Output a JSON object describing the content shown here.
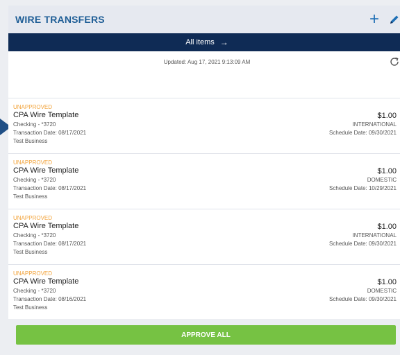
{
  "header": {
    "title": "WIRE TRANSFERS",
    "add_icon": "plus-icon",
    "edit_icon": "pencil-icon"
  },
  "filter_bar": {
    "label": "All items",
    "arrow": "→"
  },
  "status_row": {
    "updated_text": "Updated: Aug 17, 2021 9:13:09 AM",
    "refresh_icon": "refresh-icon"
  },
  "transfers": [
    {
      "status": "UNAPPROVED",
      "name": "CPA Wire Template",
      "account": "Checking - *3720",
      "transaction_date": "Transaction Date: 08/17/2021",
      "business": "Test Business",
      "amount": "$1.00",
      "type": "INTERNATIONAL",
      "schedule_date": "Schedule Date: 09/30/2021",
      "chevron": ">"
    },
    {
      "status": "UNAPPROVED",
      "name": "CPA Wire Template",
      "account": "Checking - *3720",
      "transaction_date": "Transaction Date: 08/17/2021",
      "business": "Test Business",
      "amount": "$1.00",
      "type": "DOMESTIC",
      "schedule_date": "Schedule Date: 10/29/2021",
      "chevron": ">"
    },
    {
      "status": "UNAPPROVED",
      "name": "CPA Wire Template",
      "account": "Checking - *3720",
      "transaction_date": "Transaction Date: 08/17/2021",
      "business": "Test Business",
      "amount": "$1.00",
      "type": "INTERNATIONAL",
      "schedule_date": "Schedule Date: 09/30/2021",
      "chevron": ">"
    },
    {
      "status": "UNAPPROVED",
      "name": "CPA Wire Template",
      "account": "Checking - *3720",
      "transaction_date": "Transaction Date: 08/16/2021",
      "business": "Test Business",
      "amount": "$1.00",
      "type": "DOMESTIC",
      "schedule_date": "Schedule Date: 09/30/2021",
      "chevron": ">"
    }
  ],
  "footer": {
    "approve_all_label": "APPROVE ALL"
  },
  "colors": {
    "header_title": "#1f5e96",
    "filter_bar_bg": "#0f2b55",
    "status_unapproved": "#f2a33a",
    "approve_button": "#76c243",
    "pointer_marker": "#1f4f86"
  }
}
